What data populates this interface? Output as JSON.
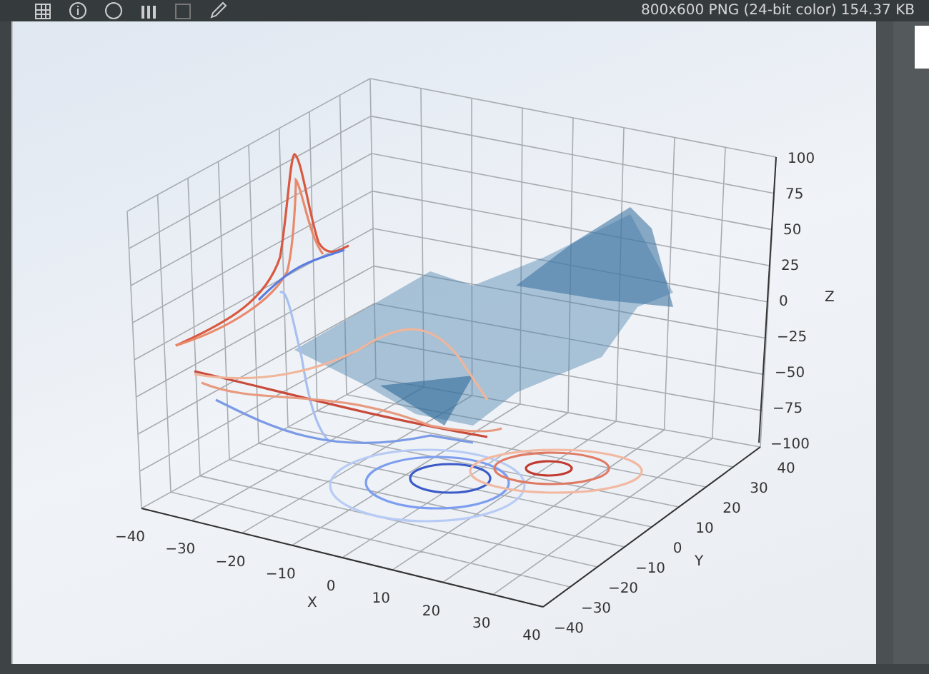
{
  "toolbar": {
    "image_info": "800x600 PNG (24-bit color) 154.37 KB"
  },
  "plot": {
    "x_axis": {
      "label": "X",
      "ticks": [
        "−40",
        "−30",
        "−20",
        "−10",
        "0",
        "10",
        "20",
        "30",
        "40"
      ]
    },
    "y_axis": {
      "label": "Y",
      "ticks": [
        "−40",
        "−30",
        "−20",
        "−10",
        "0",
        "10",
        "20",
        "30",
        "40"
      ]
    },
    "z_axis": {
      "label": "Z",
      "ticks": [
        "100",
        "75",
        "50",
        "25",
        "0",
        "−25",
        "−50",
        "−75",
        "−100"
      ]
    }
  }
}
